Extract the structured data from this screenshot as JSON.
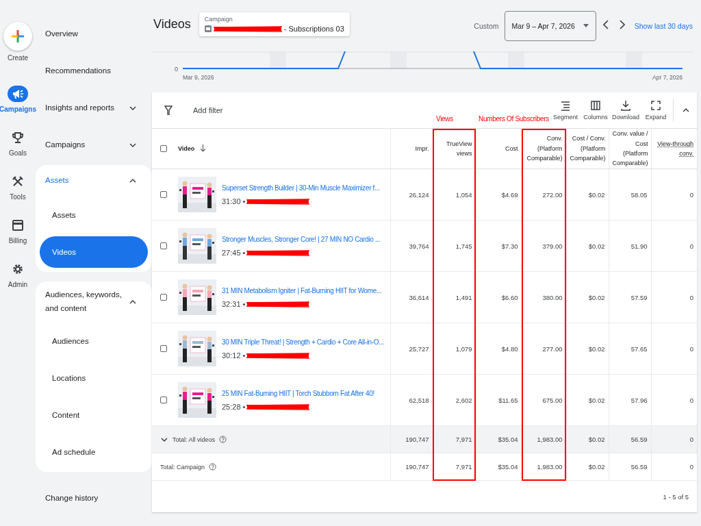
{
  "create": {
    "label": "Create"
  },
  "rail": [
    {
      "label": "Campaigns",
      "selected": true
    },
    {
      "label": "Goals",
      "selected": false
    },
    {
      "label": "Tools",
      "selected": false
    },
    {
      "label": "Billing",
      "selected": false
    },
    {
      "label": "Admin",
      "selected": false
    }
  ],
  "nav": [
    {
      "label": "Overview",
      "selected": false
    },
    {
      "label": "Recommendations",
      "selected": false
    },
    {
      "label": "Insights and reports",
      "selected": false,
      "expanded": false
    },
    {
      "label": "Campaigns",
      "selected": false,
      "expanded": false
    },
    {
      "label": "Assets",
      "selected": true,
      "expanded": true,
      "children": [
        {
          "label": "Assets",
          "selected": false
        },
        {
          "label": "Videos",
          "selected": true
        }
      ]
    },
    {
      "label": "Audiences, keywords, and content",
      "selected": false,
      "expanded": true,
      "children": [
        {
          "label": "Audiences",
          "selected": false
        },
        {
          "label": "Locations",
          "selected": false
        },
        {
          "label": "Content",
          "selected": false
        },
        {
          "label": "Ad schedule",
          "selected": false
        }
      ]
    },
    {
      "label": "Change history",
      "selected": false
    }
  ],
  "header": {
    "title": "Videos",
    "campaign_label": "Campaign",
    "campaign_name": "- Subscriptions 03",
    "date_label": "Custom",
    "date_range": "Mar 9 – Apr 7, 2026",
    "show_last": "Show last 30 days"
  },
  "chart": {
    "y_tick": "0",
    "start": "Mar 9, 2026",
    "end": "Apr 7, 2026"
  },
  "toolbar": {
    "filter": "Add filter",
    "actions": [
      "Segment",
      "Columns",
      "Download",
      "Expand"
    ]
  },
  "table": {
    "select_all": {
      "checked": false
    },
    "columns": [
      {
        "label": "Video",
        "sorted": true
      },
      {
        "label": "Impr.",
        "sorted": false
      },
      {
        "label": "TrueView views",
        "sorted": false
      },
      {
        "label": "Cost",
        "sorted": false
      },
      {
        "label": "Conv. (Platform Comparable)",
        "sorted": false
      },
      {
        "label": "Cost / Conv. (Platform Comparable)",
        "sorted": false
      },
      {
        "label": "Conv. value / Cost (Platform Comparable)",
        "sorted": false
      },
      {
        "label": "View-through conv.",
        "sorted": false
      }
    ],
    "rows": [
      {
        "checked": false,
        "title": "Superset Strength Builder | 30-Min Muscle Maximizer f...",
        "duration": "31:30 •",
        "values": [
          "26,124",
          "1,054",
          "$4.69",
          "272.00",
          "$0.02",
          "58.05",
          "0"
        ]
      },
      {
        "checked": false,
        "title": "Stronger Muscles, Stronger Core! | 27 MIN NO Cardio ...",
        "duration": "27:45 •",
        "values": [
          "39,764",
          "1,745",
          "$7.30",
          "379.00",
          "$0.02",
          "51.90",
          "0"
        ]
      },
      {
        "checked": false,
        "title": "31 MIN Metabolism Igniter | Fat-Burning HIIT for Wome...",
        "duration": "32:31 •",
        "values": [
          "36,614",
          "1,491",
          "$6.60",
          "380.00",
          "$0.02",
          "57.59",
          "0"
        ]
      },
      {
        "checked": false,
        "title": "30 MIN Triple Threat! | Strength + Cardio + Core All-in-O...",
        "duration": "30:12 •",
        "values": [
          "25,727",
          "1,079",
          "$4.80",
          "277.00",
          "$0.02",
          "57.65",
          "0"
        ]
      },
      {
        "checked": false,
        "title": "25 MIN Fat-Burning HIIT | Torch Stubborn Fat After 40!",
        "duration": "25:28 •",
        "values": [
          "62,518",
          "2,602",
          "$11.65",
          "675.00",
          "$0.02",
          "57.96",
          "0"
        ]
      }
    ],
    "totals": [
      {
        "label": "Total: All videos",
        "collapsible": true,
        "values": [
          "190,747",
          "7,971",
          "$35.04",
          "1,983.00",
          "$0.02",
          "56.59",
          "0"
        ]
      },
      {
        "label": "Total: Campaign",
        "collapsible": false,
        "values": [
          "190,747",
          "7,971",
          "$35.04",
          "1,983.00",
          "$0.02",
          "56.59",
          "0"
        ]
      }
    ],
    "pagination": "1 - 5 of 5"
  },
  "annotations": [
    {
      "text": "Views"
    },
    {
      "text": "Numbers Of Subscribers"
    }
  ]
}
